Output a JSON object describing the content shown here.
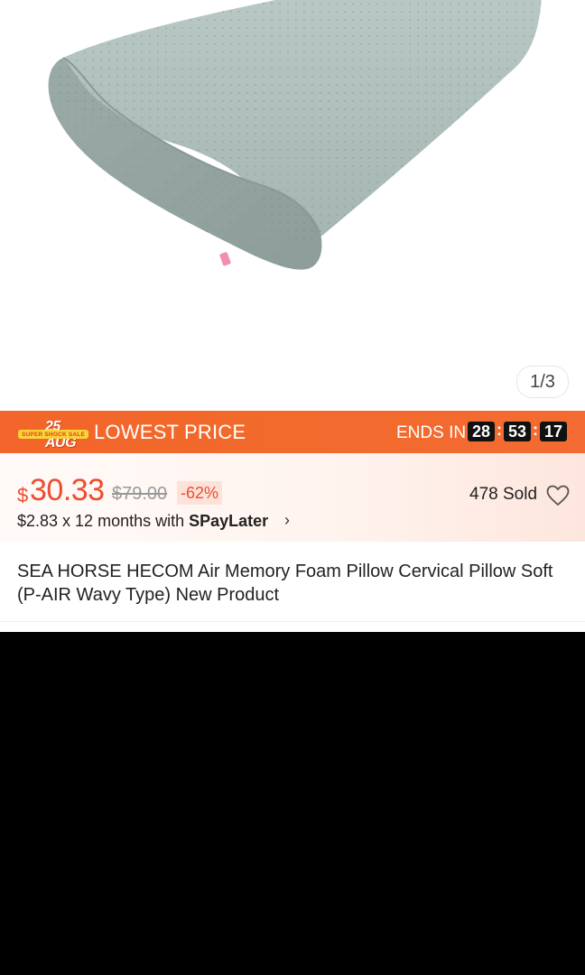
{
  "gallery": {
    "counter": "1/3",
    "product_image_alt": "memory foam pillow"
  },
  "flash_sale": {
    "campaign_date": "25 AUG",
    "campaign_tag": "SUPER SHOCK SALE",
    "label": "LOWEST PRICE",
    "ends_in_label": "ENDS IN",
    "timer": {
      "hours": "28",
      "minutes": "53",
      "seconds": "17"
    }
  },
  "pricing": {
    "currency_symbol": "$",
    "price": "30.33",
    "original_price": "$79.00",
    "discount": "-62%",
    "installment_text": "$2.83 x 12 months with ",
    "installment_provider": "SPayLater",
    "sold": "478 Sold"
  },
  "product": {
    "title": "SEA HORSE HECOM Air Memory Foam Pillow Cervical Pillow Soft (P-AIR Wavy Type) New Product"
  },
  "colors": {
    "accent": "#ee4d2d",
    "flash_bar": "#f3652a",
    "pillow": "#aebdba"
  },
  "icons": {
    "wishlist": "heart-outline-icon",
    "more": "chevron-right-icon"
  }
}
